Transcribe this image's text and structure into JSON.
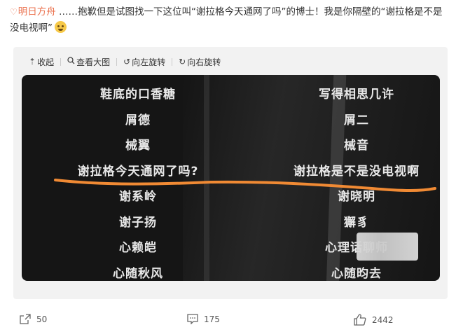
{
  "post": {
    "author": "明日方舟",
    "text": " ……抱歉但是试图找一下这位叫“谢拉格今天通网了吗”的博士！我是你隔壁的“谢拉格是不是没电视啊”"
  },
  "toolbar": {
    "collapse": "收起",
    "view_large": "查看大图",
    "rotate_left": "向左旋转",
    "rotate_right": "向右旋转"
  },
  "credits": {
    "left": [
      "鞋底的口香糖",
      "屑德",
      "械翼",
      "谢拉格今天通网了吗?",
      "谢系岭",
      "谢子扬",
      "心赖皑",
      "心随秋风"
    ],
    "right": [
      "写得相思几许",
      "屑二",
      "械音",
      "谢拉格是不是没电视啊",
      "谢晓明",
      "獬豸",
      "心理话聊师",
      "心随昀去"
    ]
  },
  "annotation": {
    "underline_color": "#f08a34"
  },
  "stats": {
    "reposts": "50",
    "comments": "175",
    "likes": "2442"
  },
  "colors": {
    "brand": "#eb7350"
  }
}
